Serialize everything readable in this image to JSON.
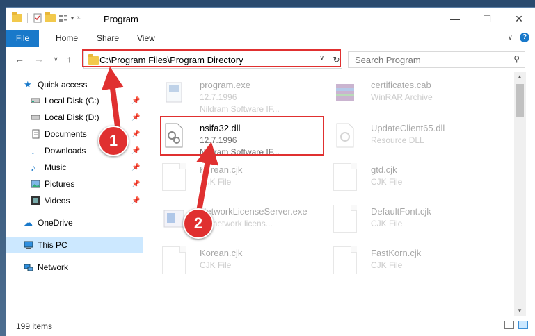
{
  "window": {
    "title": "Program"
  },
  "ribbon": {
    "tabs": [
      "File",
      "Home",
      "Share",
      "View"
    ]
  },
  "address": {
    "path": "C:\\Program Files\\Program Directory"
  },
  "search": {
    "placeholder": "Search Program"
  },
  "sidebar": {
    "quick_access": "Quick access",
    "items": [
      {
        "label": "Local Disk (C:)",
        "icon": "drive-icon"
      },
      {
        "label": "Local Disk (D:)",
        "icon": "drive-icon"
      },
      {
        "label": "Documents",
        "icon": "documents-icon"
      },
      {
        "label": "Downloads",
        "icon": "download-icon"
      },
      {
        "label": "Music",
        "icon": "music-icon"
      },
      {
        "label": "Pictures",
        "icon": "pictures-icon"
      },
      {
        "label": "Videos",
        "icon": "videos-icon"
      }
    ],
    "onedrive": "OneDrive",
    "this_pc": "This PC",
    "network": "Network"
  },
  "files": [
    {
      "name": "program.exe",
      "line2": "12.7.1996",
      "line3": "Nildram Software IF..."
    },
    {
      "name": "certificates.cab",
      "line2": "WinRAR Archive",
      "line3": ""
    },
    {
      "name": "nsifa32.dll",
      "line2": "12.7.1996",
      "line3": "Nildram Software IF..."
    },
    {
      "name": "UpdateClient65.dll",
      "line2": "Resource DLL",
      "line3": ""
    },
    {
      "name": "Korean.cjk",
      "line2": "CJK File",
      "line3": ""
    },
    {
      "name": "gtd.cjk",
      "line2": "CJK File",
      "line3": ""
    },
    {
      "name": "NetworkLicenseServer.exe",
      "line2": "EF network licens...",
      "line3": ""
    },
    {
      "name": "DefaultFont.cjk",
      "line2": "CJK File",
      "line3": ""
    },
    {
      "name": "Korean.cjk",
      "line2": "CJK File",
      "line3": ""
    },
    {
      "name": "FastKorn.cjk",
      "line2": "CJK File",
      "line3": ""
    }
  ],
  "status": {
    "items": "199 items"
  },
  "annotations": {
    "step1": "1",
    "step2": "2"
  },
  "colors": {
    "accent": "#1979ca",
    "highlight": "#e03030",
    "selection": "#cce8ff"
  }
}
